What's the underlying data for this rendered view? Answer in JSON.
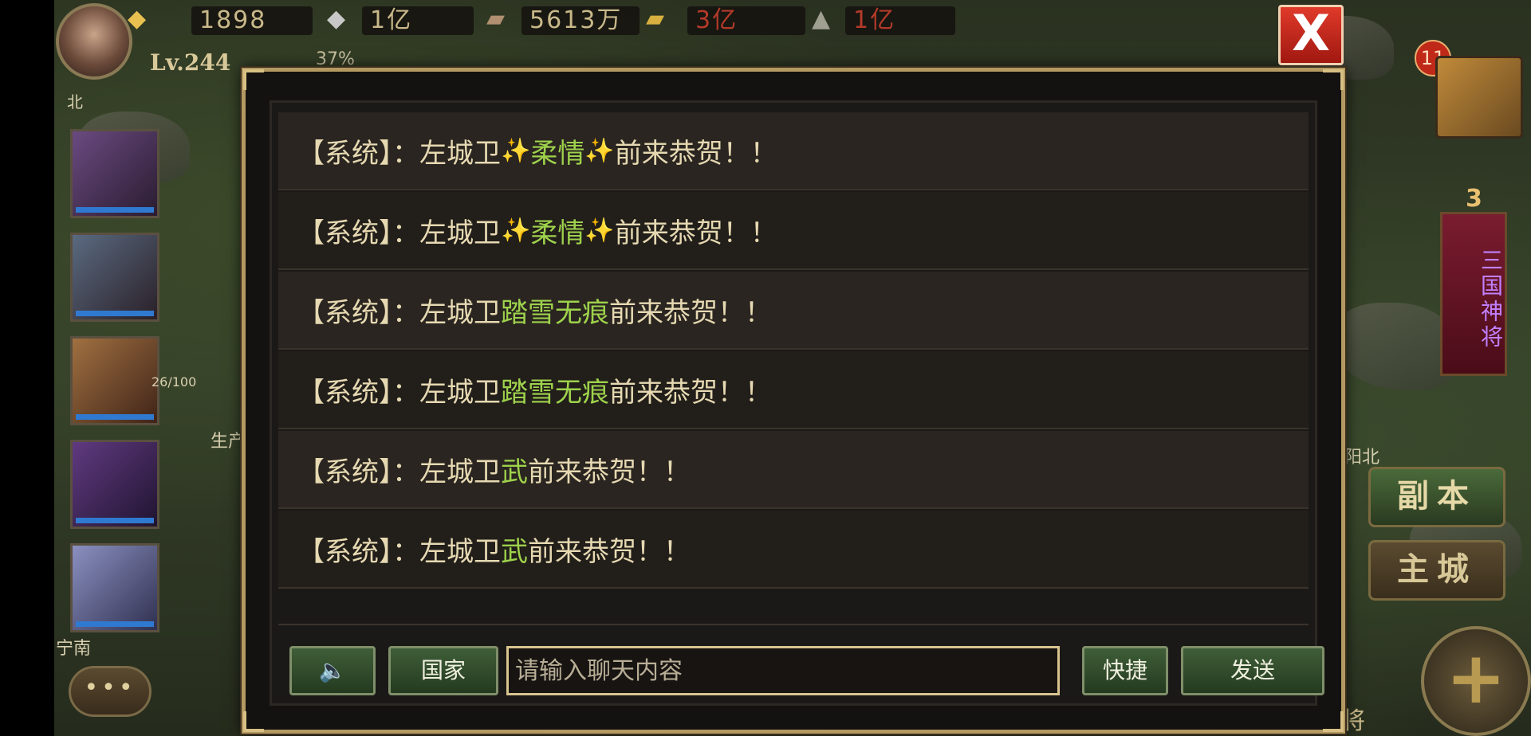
{
  "resources": {
    "gold": "1898",
    "silver": "1亿",
    "wood": "5613万",
    "food": "3亿",
    "iron": "1亿"
  },
  "player": {
    "level": "Lv.244",
    "exp_percent": "37%",
    "region": "北"
  },
  "map_labels": {
    "left_region": "宁南",
    "right_region": "阳北",
    "troop_count": "26/100",
    "produce": "生产"
  },
  "right_panel": {
    "notification_count": "11",
    "banner_rank": "3",
    "banner_text": "三国神将",
    "dungeon_label": "副本",
    "main_city_label": "主城",
    "generals_label": "武将"
  },
  "chat": {
    "close_label": "X",
    "messages": [
      {
        "prefix": "【系统】：",
        "pre": "左城卫",
        "spark_left": "✨",
        "name": "柔情",
        "spark_right": "✨",
        "suffix": "前来恭贺！！"
      },
      {
        "prefix": "【系统】：",
        "pre": "左城卫",
        "spark_left": "✨",
        "name": "柔情",
        "spark_right": "✨",
        "suffix": "前来恭贺！！"
      },
      {
        "prefix": "【系统】：",
        "pre": "左城卫",
        "spark_left": "",
        "name": "踏雪无痕",
        "spark_right": "",
        "suffix": "前来恭贺！！"
      },
      {
        "prefix": "【系统】：",
        "pre": "左城卫",
        "spark_left": "",
        "name": "踏雪无痕",
        "spark_right": "",
        "suffix": "前来恭贺！！"
      },
      {
        "prefix": "【系统】：",
        "pre": "左城卫",
        "spark_left": "",
        "name": "武",
        "spark_right": "",
        "suffix": "前来恭贺！！"
      },
      {
        "prefix": "【系统】：",
        "pre": "左城卫",
        "spark_left": "",
        "name": "武",
        "spark_right": "",
        "suffix": "前来恭贺！！"
      }
    ],
    "input_placeholder": "请输入聊天内容",
    "input_value": "",
    "speaker_label": "🔈",
    "channel_label": "国家",
    "quick_label": "快捷",
    "send_label": "发送"
  },
  "colors": {
    "name_green": "#9ed24c",
    "text_cream": "#e6d9b2",
    "border_gold": "#b49a62",
    "close_red": "#e03a2a"
  }
}
